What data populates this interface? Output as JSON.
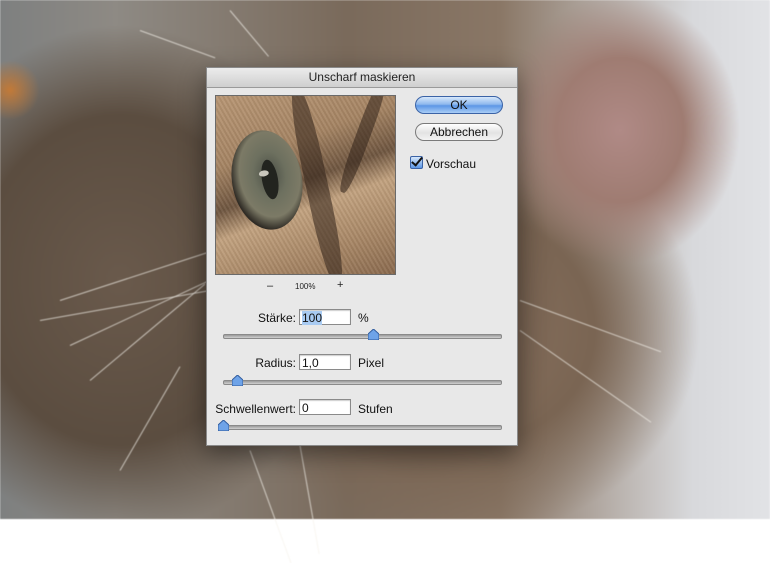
{
  "dialog": {
    "title": "Unscharf maskieren",
    "ok_label": "OK",
    "cancel_label": "Abbrechen",
    "preview_label": "Vorschau",
    "preview_checked": true,
    "zoom": {
      "minus": "–",
      "level": "100%",
      "plus": "+"
    }
  },
  "fields": {
    "amount": {
      "label": "Stärke:",
      "value": "100",
      "unit": "%",
      "slider_fraction": 0.54
    },
    "radius": {
      "label": "Radius:",
      "value": "1,0",
      "unit": "Pixel",
      "slider_fraction": 0.05
    },
    "threshold": {
      "label": "Schwellenwert:",
      "value": "0",
      "unit": "Stufen",
      "slider_fraction": 0.0
    }
  },
  "colors": {
    "accent": "#5c97e6",
    "dialog_bg": "#e8e8e8"
  }
}
